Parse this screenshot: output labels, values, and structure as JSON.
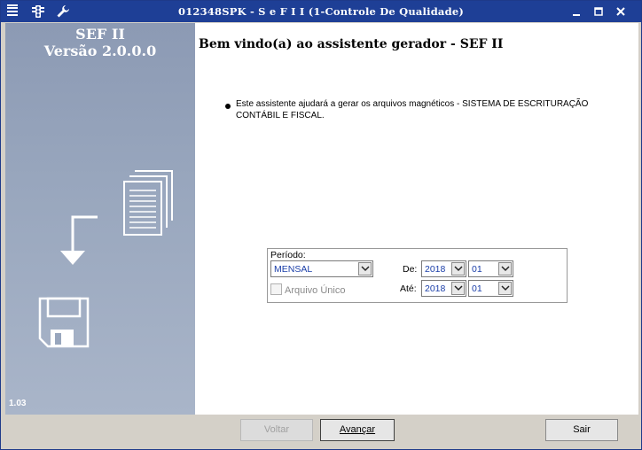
{
  "window": {
    "title": "012348SPK - S e F  I I (1-Controle De Qualidade)",
    "icons": [
      "menu-icon",
      "traffic-light-icon",
      "wrench-icon"
    ],
    "controls": [
      "minimize-icon",
      "maximize-icon",
      "close-icon"
    ]
  },
  "banner": {
    "product": "SEF II",
    "version": "Versão 2.0.0.0",
    "build": "1.03",
    "icons": [
      "documents-icon",
      "arrow-down-left-icon",
      "floppy-disk-icon"
    ]
  },
  "content": {
    "heading": "Bem vindo(a) ao assistente gerador - SEF II",
    "description": "Este assistente ajudará a gerar os arquivos magnéticos - SISTEMA DE ESCRITURAÇÃO CONTÁBIL E FISCAL."
  },
  "period": {
    "label": "Período:",
    "type_value": "MENSAL",
    "from_label": "De:",
    "from_year": "2018",
    "from_month": "01",
    "to_label": "Até:",
    "to_year": "2018",
    "to_month": "01",
    "single_file_label": "Arquivo Único",
    "single_file_checked": false
  },
  "buttons": {
    "back": "Voltar",
    "next": "Avançar",
    "exit": "Sair"
  },
  "colors": {
    "titlebar": "#1e3f96",
    "banner": "#98a6bd",
    "value_text": "#1a3ea8"
  }
}
